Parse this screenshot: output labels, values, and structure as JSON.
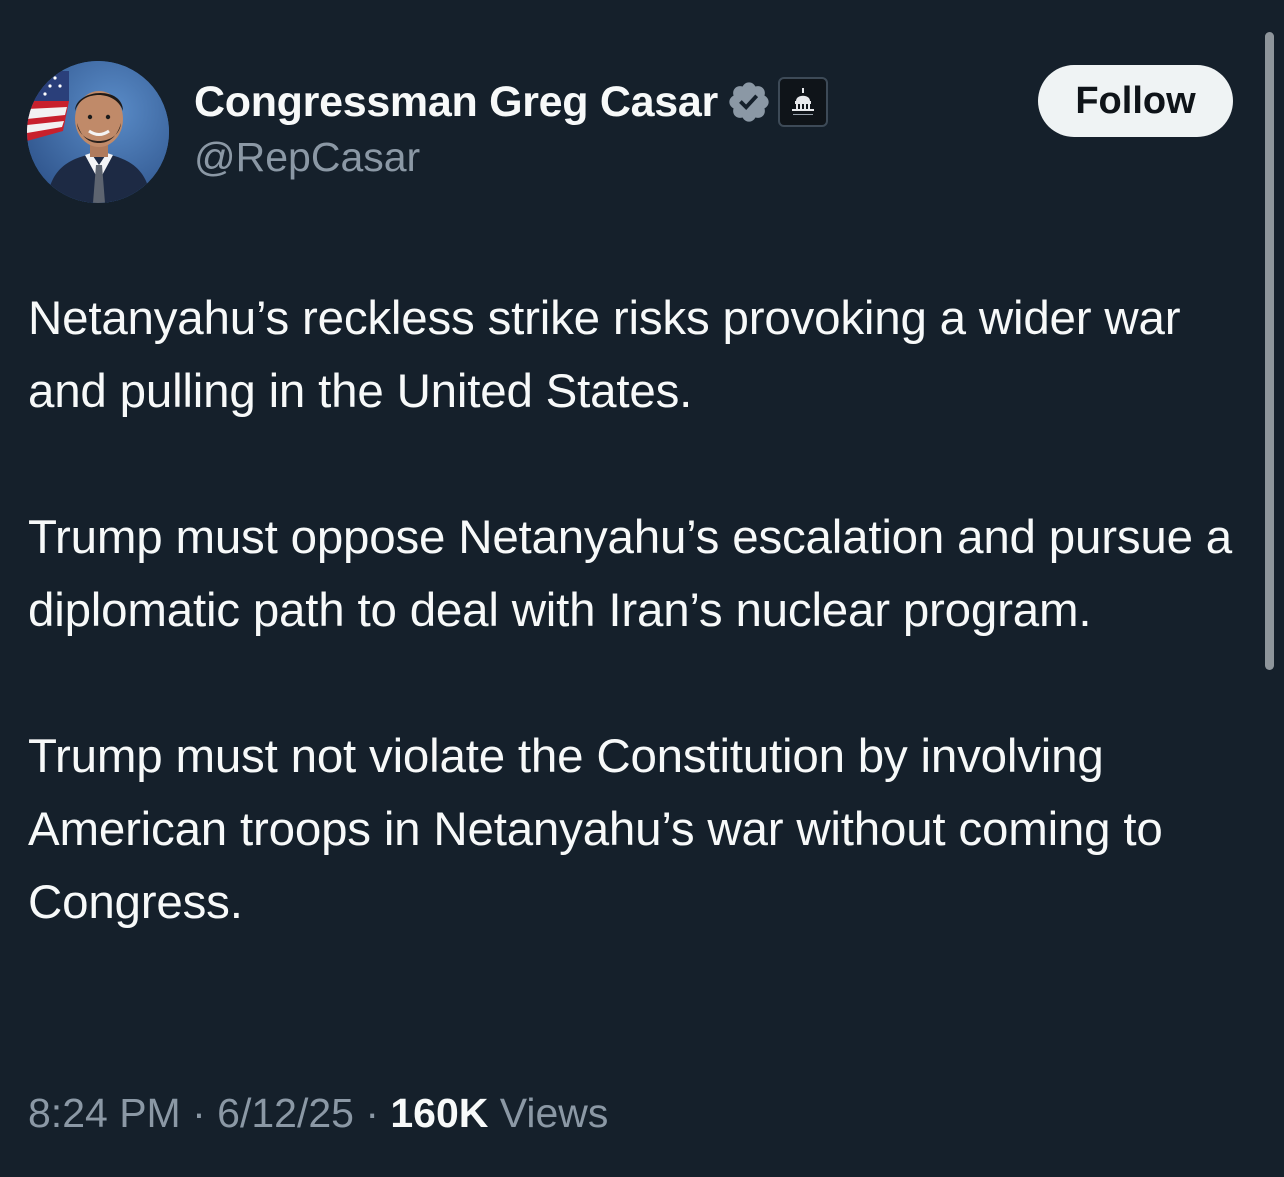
{
  "author": {
    "display_name": "Congressman Greg Casar",
    "handle": "@RepCasar",
    "avatar": "avatar-photo",
    "verified_icon": "verified-badge-icon",
    "affiliation_icon": "capitol-dome-icon"
  },
  "follow_button": {
    "label": "Follow"
  },
  "tweet": {
    "paragraphs": [
      "Netanyahu’s reckless strike risks provoking a wider war and pulling in the United States.",
      "Trump must oppose Netanyahu’s escalation and pursue a diplomatic path to deal with Iran’s nuclear program.",
      "Trump must not violate the Constitution by involving American troops in Netanyahu’s war without coming to Congress."
    ]
  },
  "meta": {
    "time": "8:24 PM",
    "separator": " · ",
    "date": "6/12/25",
    "views_count": "160K",
    "views_label": " Views"
  },
  "colors": {
    "background": "#15202b",
    "text_primary": "#f7f9f9",
    "text_secondary": "#8b98a5",
    "follow_bg": "#eff3f4",
    "verified_badge": "#8b98a5"
  }
}
